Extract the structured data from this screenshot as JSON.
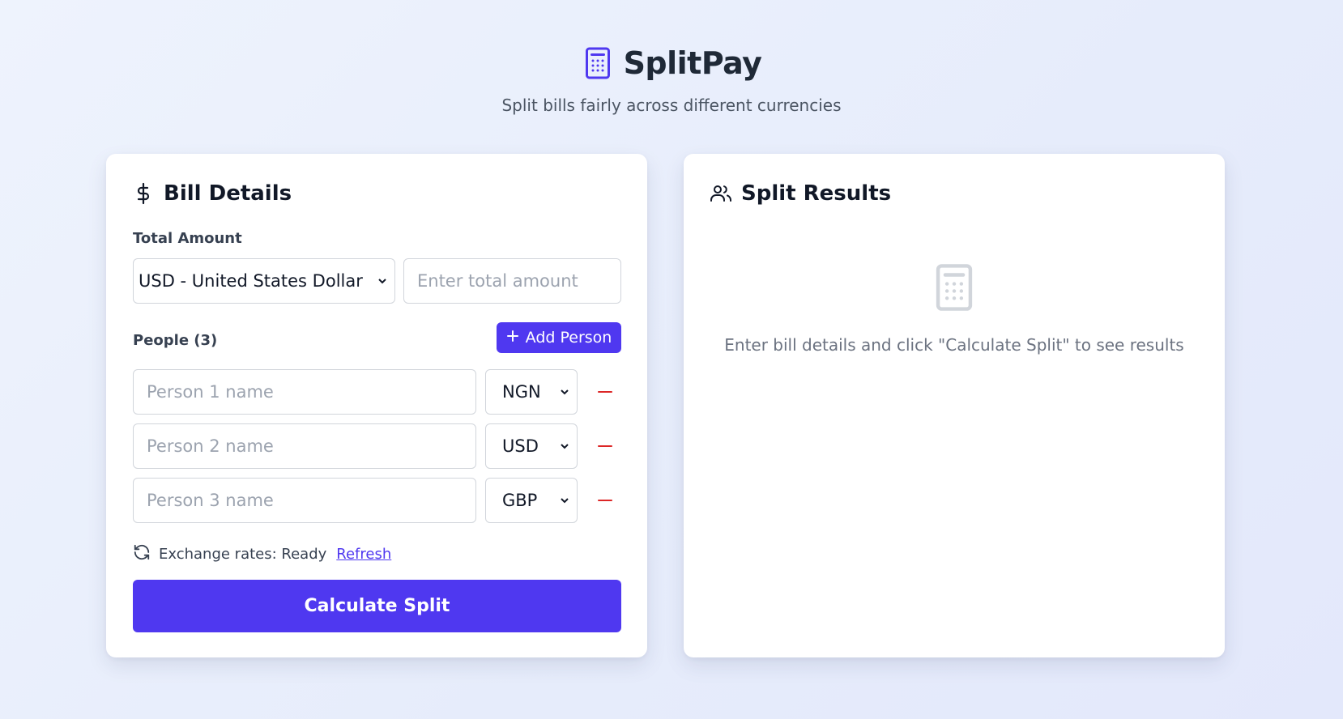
{
  "app": {
    "title": "SplitPay",
    "subtitle": "Split bills fairly across different currencies",
    "accent": "#4f38f0",
    "icon": "calculator-icon"
  },
  "bill": {
    "title": "Bill Details",
    "icon": "dollar-icon",
    "total_label": "Total Amount",
    "currency_selected": "USD - United States Dollar",
    "amount_placeholder": "Enter total amount",
    "people_label": "People (3)",
    "add_person_label": "Add Person",
    "people": [
      {
        "name_placeholder": "Person 1 name",
        "currency": "NGN"
      },
      {
        "name_placeholder": "Person 2 name",
        "currency": "USD"
      },
      {
        "name_placeholder": "Person 3 name",
        "currency": "GBP"
      }
    ],
    "rates_status": "Exchange rates: Ready",
    "refresh_label": "Refresh",
    "calculate_label": "Calculate Split"
  },
  "results": {
    "title": "Split Results",
    "icon": "users-icon",
    "empty_icon": "calculator-icon",
    "empty_text": "Enter bill details and click \"Calculate Split\" to see results"
  }
}
